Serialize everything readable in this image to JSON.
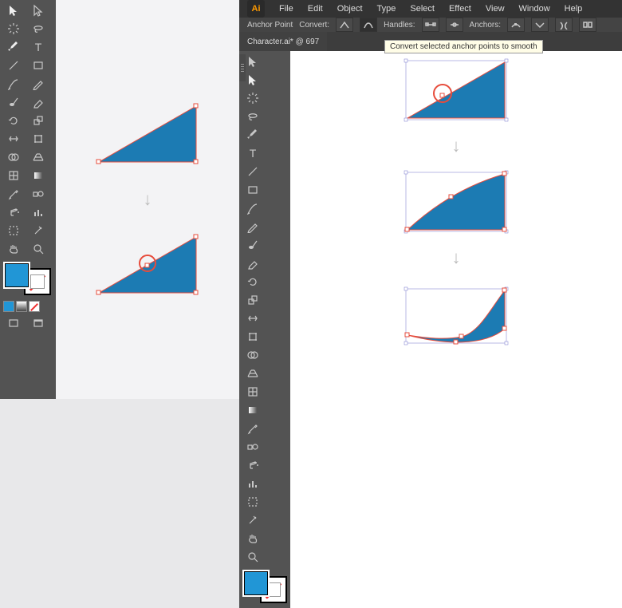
{
  "app": {
    "badge": "Ai"
  },
  "menu": [
    "File",
    "Edit",
    "Object",
    "Type",
    "Select",
    "Effect",
    "View",
    "Window",
    "Help"
  ],
  "controlbar": {
    "context": "Anchor Point",
    "convert_label": "Convert:",
    "handles_label": "Handles:",
    "anchors_label": "Anchors:"
  },
  "tooltip": "Convert selected anchor points to smooth",
  "document": {
    "tab": "Character.ai* @ 697"
  },
  "colors": {
    "fill": "#1c7bb3",
    "stroke": "#e74c3c",
    "swatch_fill": "#2196d6"
  },
  "arrow_glyph": "↓"
}
